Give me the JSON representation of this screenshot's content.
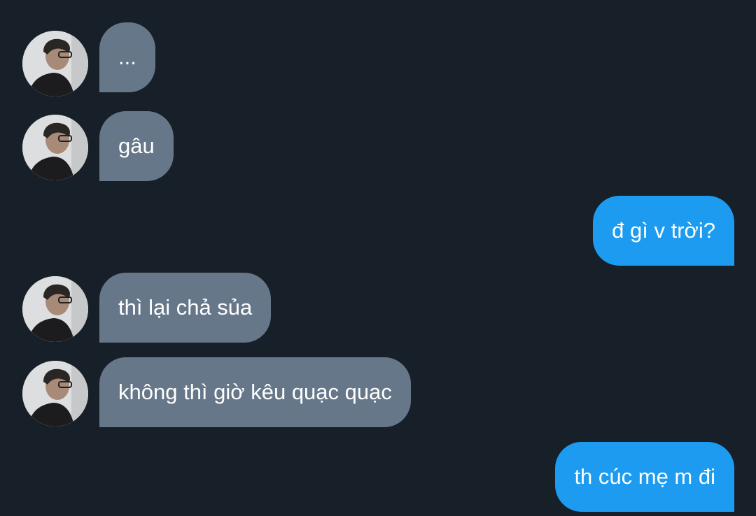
{
  "conversation": {
    "messages": [
      {
        "direction": "incoming",
        "text": "..."
      },
      {
        "direction": "incoming",
        "text": "gâu"
      },
      {
        "direction": "outgoing",
        "text": "đ gì v trời?"
      },
      {
        "direction": "incoming",
        "text": "thì lại chả sủa"
      },
      {
        "direction": "incoming",
        "text": "không thì giờ kêu quạc quạc"
      },
      {
        "direction": "outgoing",
        "text": "th cúc mẹ m đi"
      }
    ]
  },
  "colors": {
    "background": "#171f28",
    "incoming_bubble": "#66778a",
    "outgoing_bubble": "#1d9bf0",
    "text": "#ffffff"
  }
}
